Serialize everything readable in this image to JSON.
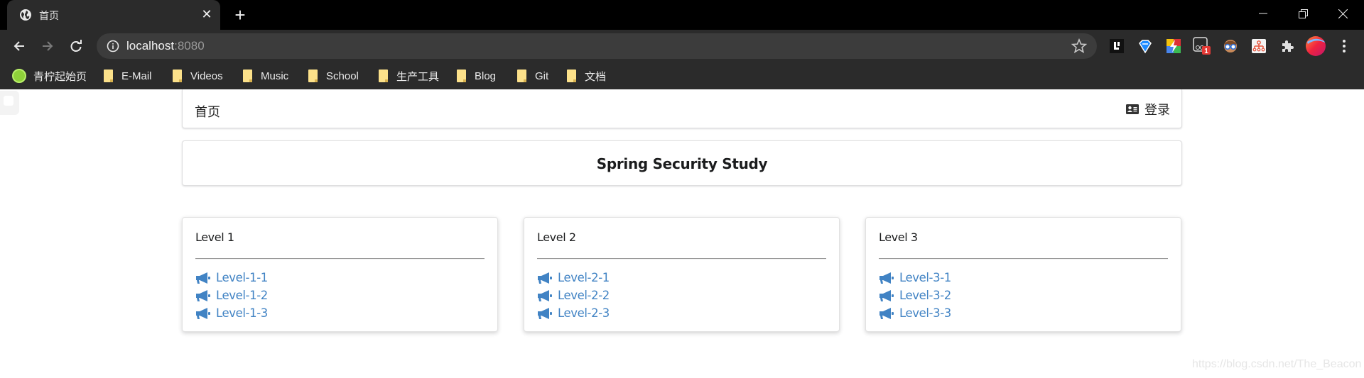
{
  "browser": {
    "tab": {
      "title": "首页",
      "favicon": "globe-icon"
    },
    "address": {
      "host": "localhost",
      "port": ":8080"
    },
    "extensions": [
      {
        "name": "lingq-extension-icon"
      },
      {
        "name": "diamond-extension-icon"
      },
      {
        "name": "bolt-extension-icon"
      },
      {
        "name": "tracker-extension-icon",
        "badge": "1"
      },
      {
        "name": "glasses-extension-icon"
      },
      {
        "name": "sitemap-extension-icon"
      },
      {
        "name": "puzzle-extensions-icon"
      },
      {
        "name": "profile-avatar-icon"
      },
      {
        "name": "more-menu-icon"
      }
    ],
    "bookmarks": [
      {
        "label": "青柠起始页",
        "icon": "lime-icon"
      },
      {
        "label": "E-Mail",
        "icon": "folder-icon"
      },
      {
        "label": "Videos",
        "icon": "folder-icon"
      },
      {
        "label": "Music",
        "icon": "folder-icon"
      },
      {
        "label": "School",
        "icon": "folder-icon"
      },
      {
        "label": "生产工具",
        "icon": "folder-icon"
      },
      {
        "label": "Blog",
        "icon": "folder-icon"
      },
      {
        "label": "Git",
        "icon": "folder-icon"
      },
      {
        "label": "文档",
        "icon": "folder-icon"
      }
    ]
  },
  "nav": {
    "home": "首页",
    "login": "登录",
    "login_icon": "id-card-icon"
  },
  "header": {
    "title": "Spring Security Study"
  },
  "cards": [
    {
      "title": "Level 1",
      "links": [
        "Level-1-1",
        "Level-1-2",
        "Level-1-3"
      ]
    },
    {
      "title": "Level 2",
      "links": [
        "Level-2-1",
        "Level-2-2",
        "Level-2-3"
      ]
    },
    {
      "title": "Level 3",
      "links": [
        "Level-3-1",
        "Level-3-2",
        "Level-3-3"
      ]
    }
  ],
  "colors": {
    "link": "#4183c4",
    "chrome_dark": "#2b2b2b"
  },
  "watermark": "https://blog.csdn.net/The_Beacon"
}
